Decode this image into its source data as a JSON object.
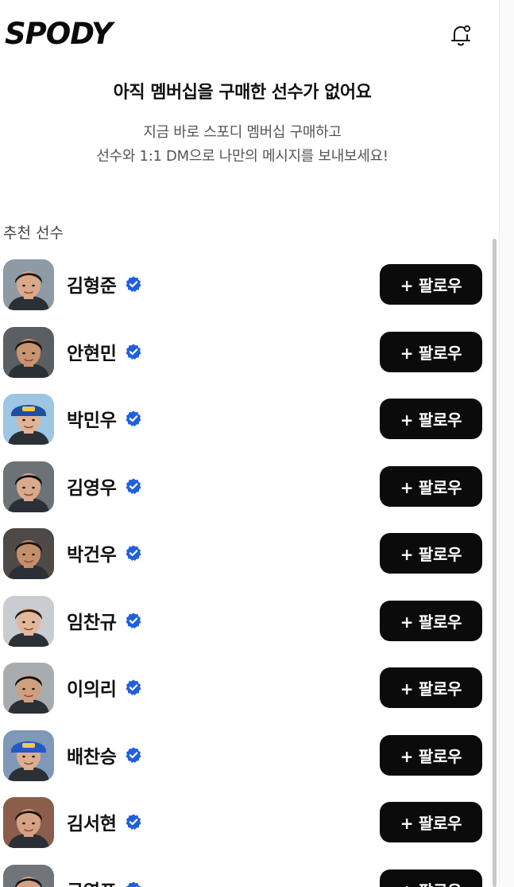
{
  "header": {
    "logo_text": "SPODY",
    "bell_icon": "bell-icon"
  },
  "empty_state": {
    "title": "아직 멤버십을 구매한 선수가 없어요",
    "desc_line1": "지금 바로 스포디 멤버십 구매하고",
    "desc_line2": "선수와 1:1 DM으로 나만의 메시지를 보내보세요!"
  },
  "recommended": {
    "title": "추천 선수",
    "follow_label": "+ 팔로우",
    "players": [
      {
        "name": "김형준",
        "skin": "#d9a98a",
        "hair": "#1d1a18",
        "bg": "#8e9aa4",
        "cap": ""
      },
      {
        "name": "안현민",
        "skin": "#c9946f",
        "hair": "#141210",
        "bg": "#5b5f63",
        "cap": ""
      },
      {
        "name": "박민우",
        "skin": "#e0b397",
        "hair": "#2a211c",
        "bg": "#9cc6e4",
        "cap": "#1e4fa0"
      },
      {
        "name": "김영우",
        "skin": "#d8a98b",
        "hair": "#0f0d0c",
        "bg": "#6d7277",
        "cap": ""
      },
      {
        "name": "박건우",
        "skin": "#c58f6a",
        "hair": "#1a1614",
        "bg": "#4d4a48",
        "cap": ""
      },
      {
        "name": "임찬규",
        "skin": "#e3b79b",
        "hair": "#221c18",
        "bg": "#c9ccd0",
        "cap": ""
      },
      {
        "name": "이의리",
        "skin": "#cf9f7f",
        "hair": "#0f0e0d",
        "bg": "#a9acae",
        "cap": ""
      },
      {
        "name": "배찬승",
        "skin": "#dcae90",
        "hair": "#1b1714",
        "bg": "#7f98b8",
        "cap": "#2358c7"
      },
      {
        "name": "김서현",
        "skin": "#d6a283",
        "hair": "#1a1512",
        "bg": "#8a5e4a",
        "cap": ""
      },
      {
        "name": "구영표",
        "skin": "#d2a184",
        "hair": "#141210",
        "bg": "#70757a",
        "cap": ""
      }
    ]
  },
  "colors": {
    "verified": "#1f5fe0",
    "button_bg": "#0b0b0b",
    "button_text": "#ffffff"
  }
}
